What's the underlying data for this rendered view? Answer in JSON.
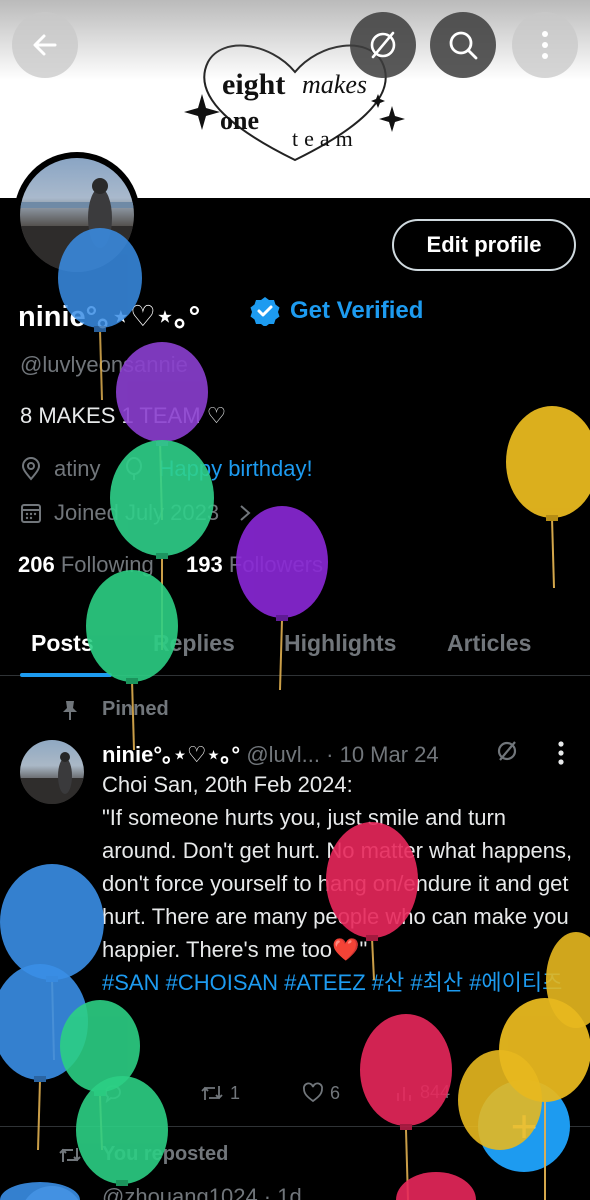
{
  "banner": {
    "logo_line1": "eight",
    "logo_line2": "makes",
    "logo_line3": "one",
    "logo_line4": "team"
  },
  "toolbar": {
    "back_icon": "arrow-left-icon",
    "hidden_icon": "slashed-circle-icon",
    "search_icon": "search-icon",
    "more_icon": "more-vertical-icon"
  },
  "profile": {
    "edit_label": "Edit profile",
    "name": "ninie°｡⋆♡⋆｡°",
    "get_verified": "Get Verified",
    "handle": "@luvlyeonsannie",
    "bio": "8 MAKES 1 TEAM ♡",
    "location": "atiny",
    "birthday_link": "Happy birthday!",
    "joined": "Joined July 2023",
    "following_count": "206",
    "following_label": "Following",
    "followers_count": "193",
    "followers_label": "Followers"
  },
  "tabs": [
    {
      "label": "Posts",
      "active": true
    },
    {
      "label": "Replies",
      "active": false
    },
    {
      "label": "Highlights",
      "active": false
    },
    {
      "label": "Articles",
      "active": false
    }
  ],
  "pinned_post": {
    "pinned_label": "Pinned",
    "author_name": "ninie°｡⋆♡⋆｡°",
    "author_handle": "@luvl...",
    "date": "· 10 Mar 24",
    "line1": "Choi San, 20th Feb 2024:",
    "quote": "\"If someone hurts you, just smile and turn around. Don't get hurt. No matter what happens, don't force yourself to hang on/endure it and get hurt. There are many people who can make you happier. There's me too",
    "heart": "❤️",
    "quote_end": "\"",
    "hashtags": "#SAN #CHOISAN #ATEEZ #산 #최산 #에이티즈",
    "reposts": "1",
    "likes": "6",
    "views": "844"
  },
  "next_post": {
    "reposted_label": "You reposted",
    "author_handle": "@zhouang1024 · 1d"
  },
  "colors": {
    "accent": "#1d9bf0",
    "background": "#000000",
    "muted": "#71767b"
  }
}
